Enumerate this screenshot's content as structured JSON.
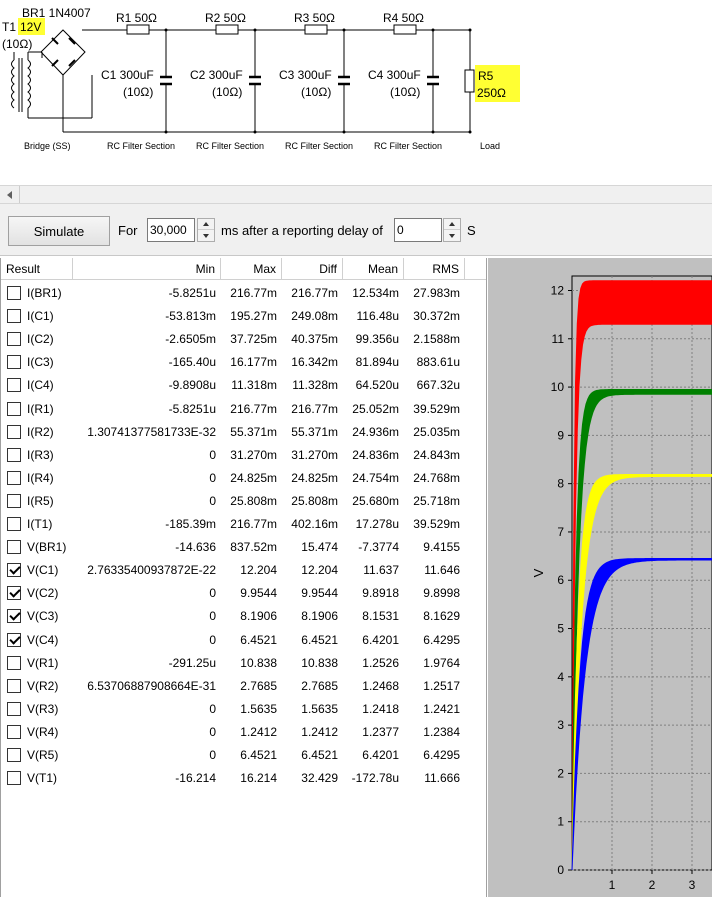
{
  "schematic": {
    "t1": "T1",
    "t1_voltage": "12V",
    "t1_res": "(10Ω)",
    "br1": "BR1 1N4007",
    "resistors": [
      "R1 50Ω",
      "R2 50Ω",
      "R3 50Ω",
      "R4 50Ω"
    ],
    "capacitors": [
      {
        "name": "C1 300uF",
        "res": "(10Ω)"
      },
      {
        "name": "C2 300uF",
        "res": "(10Ω)"
      },
      {
        "name": "C3 300uF",
        "res": "(10Ω)"
      },
      {
        "name": "C4 300uF",
        "res": "(10Ω)"
      }
    ],
    "load_name": "R5",
    "load_value": "250Ω",
    "section_labels": [
      "Bridge (SS)",
      "RC Filter Section",
      "RC Filter Section",
      "RC Filter Section",
      "RC Filter Section",
      "Load"
    ]
  },
  "toolbar": {
    "simulate_label": "Simulate",
    "for_label": "For",
    "duration_value": "30,000",
    "ms_label": "ms  after a reporting delay of",
    "delay_value": "0",
    "s_label": "S"
  },
  "table": {
    "headers": [
      "Result",
      "Min",
      "Max",
      "Diff",
      "Mean",
      "RMS"
    ],
    "rows": [
      {
        "name": "I(BR1)",
        "checked": false,
        "min": "-5.8251u",
        "max": "216.77m",
        "diff": "216.77m",
        "mean": "12.534m",
        "rms": "27.983m"
      },
      {
        "name": "I(C1)",
        "checked": false,
        "min": "-53.813m",
        "max": "195.27m",
        "diff": "249.08m",
        "mean": "116.48u",
        "rms": "30.372m"
      },
      {
        "name": "I(C2)",
        "checked": false,
        "min": "-2.6505m",
        "max": "37.725m",
        "diff": "40.375m",
        "mean": "99.356u",
        "rms": "2.1588m"
      },
      {
        "name": "I(C3)",
        "checked": false,
        "min": "-165.40u",
        "max": "16.177m",
        "diff": "16.342m",
        "mean": "81.894u",
        "rms": "883.61u"
      },
      {
        "name": "I(C4)",
        "checked": false,
        "min": "-9.8908u",
        "max": "11.318m",
        "diff": "11.328m",
        "mean": "64.520u",
        "rms": "667.32u"
      },
      {
        "name": "I(R1)",
        "checked": false,
        "min": "-5.8251u",
        "max": "216.77m",
        "diff": "216.77m",
        "mean": "25.052m",
        "rms": "39.529m"
      },
      {
        "name": "I(R2)",
        "checked": false,
        "min": "1.30741377581733E-32",
        "max": "55.371m",
        "diff": "55.371m",
        "mean": "24.936m",
        "rms": "25.035m"
      },
      {
        "name": "I(R3)",
        "checked": false,
        "min": "0",
        "max": "31.270m",
        "diff": "31.270m",
        "mean": "24.836m",
        "rms": "24.843m"
      },
      {
        "name": "I(R4)",
        "checked": false,
        "min": "0",
        "max": "24.825m",
        "diff": "24.825m",
        "mean": "24.754m",
        "rms": "24.768m"
      },
      {
        "name": "I(R5)",
        "checked": false,
        "min": "0",
        "max": "25.808m",
        "diff": "25.808m",
        "mean": "25.680m",
        "rms": "25.718m"
      },
      {
        "name": "I(T1)",
        "checked": false,
        "min": "-185.39m",
        "max": "216.77m",
        "diff": "402.16m",
        "mean": "17.278u",
        "rms": "39.529m"
      },
      {
        "name": "V(BR1)",
        "checked": false,
        "min": "-14.636",
        "max": "837.52m",
        "diff": "15.474",
        "mean": "-7.3774",
        "rms": "9.4155"
      },
      {
        "name": "V(C1)",
        "checked": true,
        "min": "2.76335400937872E-22",
        "max": "12.204",
        "diff": "12.204",
        "mean": "11.637",
        "rms": "11.646"
      },
      {
        "name": "V(C2)",
        "checked": true,
        "min": "0",
        "max": "9.9544",
        "diff": "9.9544",
        "mean": "9.8918",
        "rms": "9.8998"
      },
      {
        "name": "V(C3)",
        "checked": true,
        "min": "0",
        "max": "8.1906",
        "diff": "8.1906",
        "mean": "8.1531",
        "rms": "8.1629"
      },
      {
        "name": "V(C4)",
        "checked": true,
        "min": "0",
        "max": "6.4521",
        "diff": "6.4521",
        "mean": "6.4201",
        "rms": "6.4295"
      },
      {
        "name": "V(R1)",
        "checked": false,
        "min": "-291.25u",
        "max": "10.838",
        "diff": "10.838",
        "mean": "1.2526",
        "rms": "1.9764"
      },
      {
        "name": "V(R2)",
        "checked": false,
        "min": "6.53706887908664E-31",
        "max": "2.7685",
        "diff": "2.7685",
        "mean": "1.2468",
        "rms": "1.2517"
      },
      {
        "name": "V(R3)",
        "checked": false,
        "min": "0",
        "max": "1.5635",
        "diff": "1.5635",
        "mean": "1.2418",
        "rms": "1.2421"
      },
      {
        "name": "V(R4)",
        "checked": false,
        "min": "0",
        "max": "1.2412",
        "diff": "1.2412",
        "mean": "1.2377",
        "rms": "1.2384"
      },
      {
        "name": "V(R5)",
        "checked": false,
        "min": "0",
        "max": "6.4521",
        "diff": "6.4521",
        "mean": "6.4201",
        "rms": "6.4295"
      },
      {
        "name": "V(T1)",
        "checked": false,
        "min": "-16.214",
        "max": "16.214",
        "diff": "32.429",
        "mean": "-172.78u",
        "rms": "11.666"
      }
    ]
  },
  "chart_data": {
    "type": "line",
    "ylabel": "V",
    "ylim": [
      0,
      12.3
    ],
    "xlim": [
      0,
      3.5
    ],
    "yticks": [
      "0",
      "1",
      "2",
      "3",
      "4",
      "5",
      "6",
      "7",
      "8",
      "9",
      "10",
      "11",
      "12"
    ],
    "xticks": [
      "1",
      "2",
      "3"
    ],
    "grid": true,
    "series": [
      {
        "color": "#ff0000",
        "final_min": 11.3,
        "final_max": 12.2,
        "tau": 0.05
      },
      {
        "color": "#008000",
        "final_min": 9.85,
        "final_max": 9.95,
        "tau": 0.1
      },
      {
        "color": "#ffff00",
        "final_min": 8.15,
        "final_max": 8.19,
        "tau": 0.15
      },
      {
        "color": "#0000ff",
        "final_min": 6.42,
        "final_max": 6.45,
        "tau": 0.2
      }
    ]
  }
}
